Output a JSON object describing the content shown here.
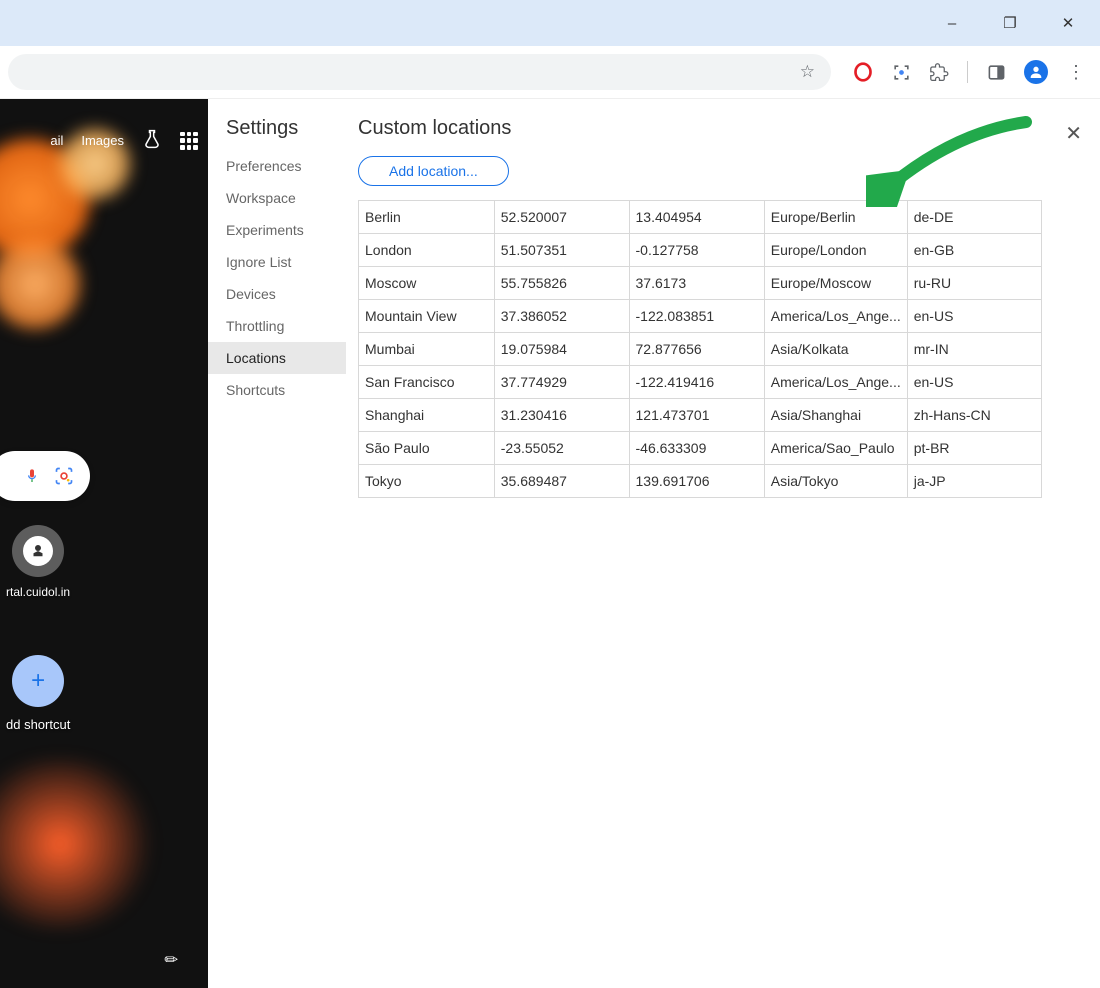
{
  "window": {
    "minimize": "–",
    "maximize": "❐",
    "close": "✕"
  },
  "page": {
    "toplink_mail": "ail",
    "toplink_images": "Images",
    "shortcut_label": "rtal.cuidol.in",
    "add_shortcut_label": "dd shortcut"
  },
  "devtools": {
    "settings_title": "Settings",
    "sidebar_items": [
      {
        "label": "Preferences",
        "active": false
      },
      {
        "label": "Workspace",
        "active": false
      },
      {
        "label": "Experiments",
        "active": false
      },
      {
        "label": "Ignore List",
        "active": false
      },
      {
        "label": "Devices",
        "active": false
      },
      {
        "label": "Throttling",
        "active": false
      },
      {
        "label": "Locations",
        "active": true
      },
      {
        "label": "Shortcuts",
        "active": false
      }
    ],
    "panel_title": "Custom locations",
    "add_button": "Add location...",
    "locations": [
      {
        "name": "Berlin",
        "lat": "52.520007",
        "lon": "13.404954",
        "tz": "Europe/Berlin",
        "locale": "de-DE"
      },
      {
        "name": "London",
        "lat": "51.507351",
        "lon": "-0.127758",
        "tz": "Europe/London",
        "locale": "en-GB"
      },
      {
        "name": "Moscow",
        "lat": "55.755826",
        "lon": "37.6173",
        "tz": "Europe/Moscow",
        "locale": "ru-RU"
      },
      {
        "name": "Mountain View",
        "lat": "37.386052",
        "lon": "-122.083851",
        "tz": "America/Los_Ange...",
        "locale": "en-US"
      },
      {
        "name": "Mumbai",
        "lat": "19.075984",
        "lon": "72.877656",
        "tz": "Asia/Kolkata",
        "locale": "mr-IN"
      },
      {
        "name": "San Francisco",
        "lat": "37.774929",
        "lon": "-122.419416",
        "tz": "America/Los_Ange...",
        "locale": "en-US"
      },
      {
        "name": "Shanghai",
        "lat": "31.230416",
        "lon": "121.473701",
        "tz": "Asia/Shanghai",
        "locale": "zh-Hans-CN"
      },
      {
        "name": "São Paulo",
        "lat": "-23.55052",
        "lon": "-46.633309",
        "tz": "America/Sao_Paulo",
        "locale": "pt-BR"
      },
      {
        "name": "Tokyo",
        "lat": "35.689487",
        "lon": "139.691706",
        "tz": "Asia/Tokyo",
        "locale": "ja-JP"
      }
    ]
  }
}
